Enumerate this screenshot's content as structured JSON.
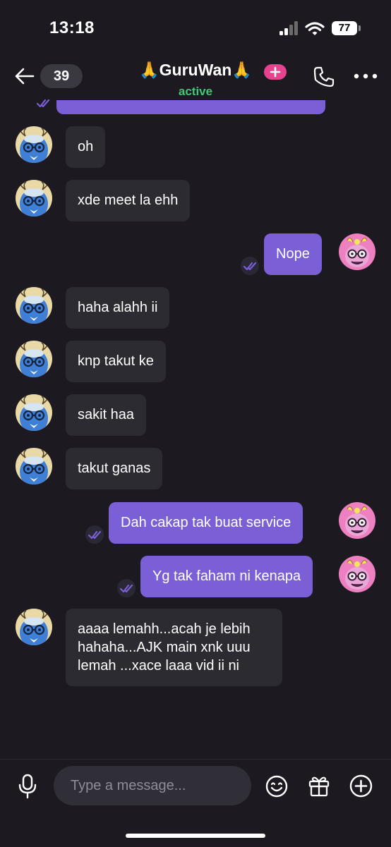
{
  "status_bar": {
    "time": "13:18",
    "battery": "77"
  },
  "header": {
    "back_count": "39",
    "title": "🙏GuruWan🙏",
    "status": "active"
  },
  "colors": {
    "accent": "#7b5fd6",
    "incoming_bubble": "#2c2b31",
    "active": "#42c776",
    "plus_badge": "#e6428d"
  },
  "messages": [
    {
      "side": "in",
      "text": "oh"
    },
    {
      "side": "in",
      "text": "xde meet la ehh"
    },
    {
      "side": "out",
      "text": "Nope"
    },
    {
      "side": "in",
      "text": "haha alahh ii"
    },
    {
      "side": "in",
      "text": "knp takut ke"
    },
    {
      "side": "in",
      "text": "sakit haa"
    },
    {
      "side": "in",
      "text": "takut ganas"
    },
    {
      "side": "out",
      "text": "Dah cakap tak buat service"
    },
    {
      "side": "out",
      "text": "Yg tak faham ni kenapa"
    },
    {
      "side": "in",
      "lines": [
        "aaaa lemahh...acah je lebih",
        "hahaha...AJK main xnk uuu",
        "lemah ...xace laaa vid ii ni"
      ]
    }
  ],
  "composer": {
    "placeholder": "Type a message..."
  },
  "icons": [
    "back-arrow-icon",
    "plus-icon",
    "phone-icon",
    "more-icon",
    "read-receipt-icon",
    "microphone-icon",
    "emoji-icon",
    "gift-icon",
    "add-icon"
  ]
}
